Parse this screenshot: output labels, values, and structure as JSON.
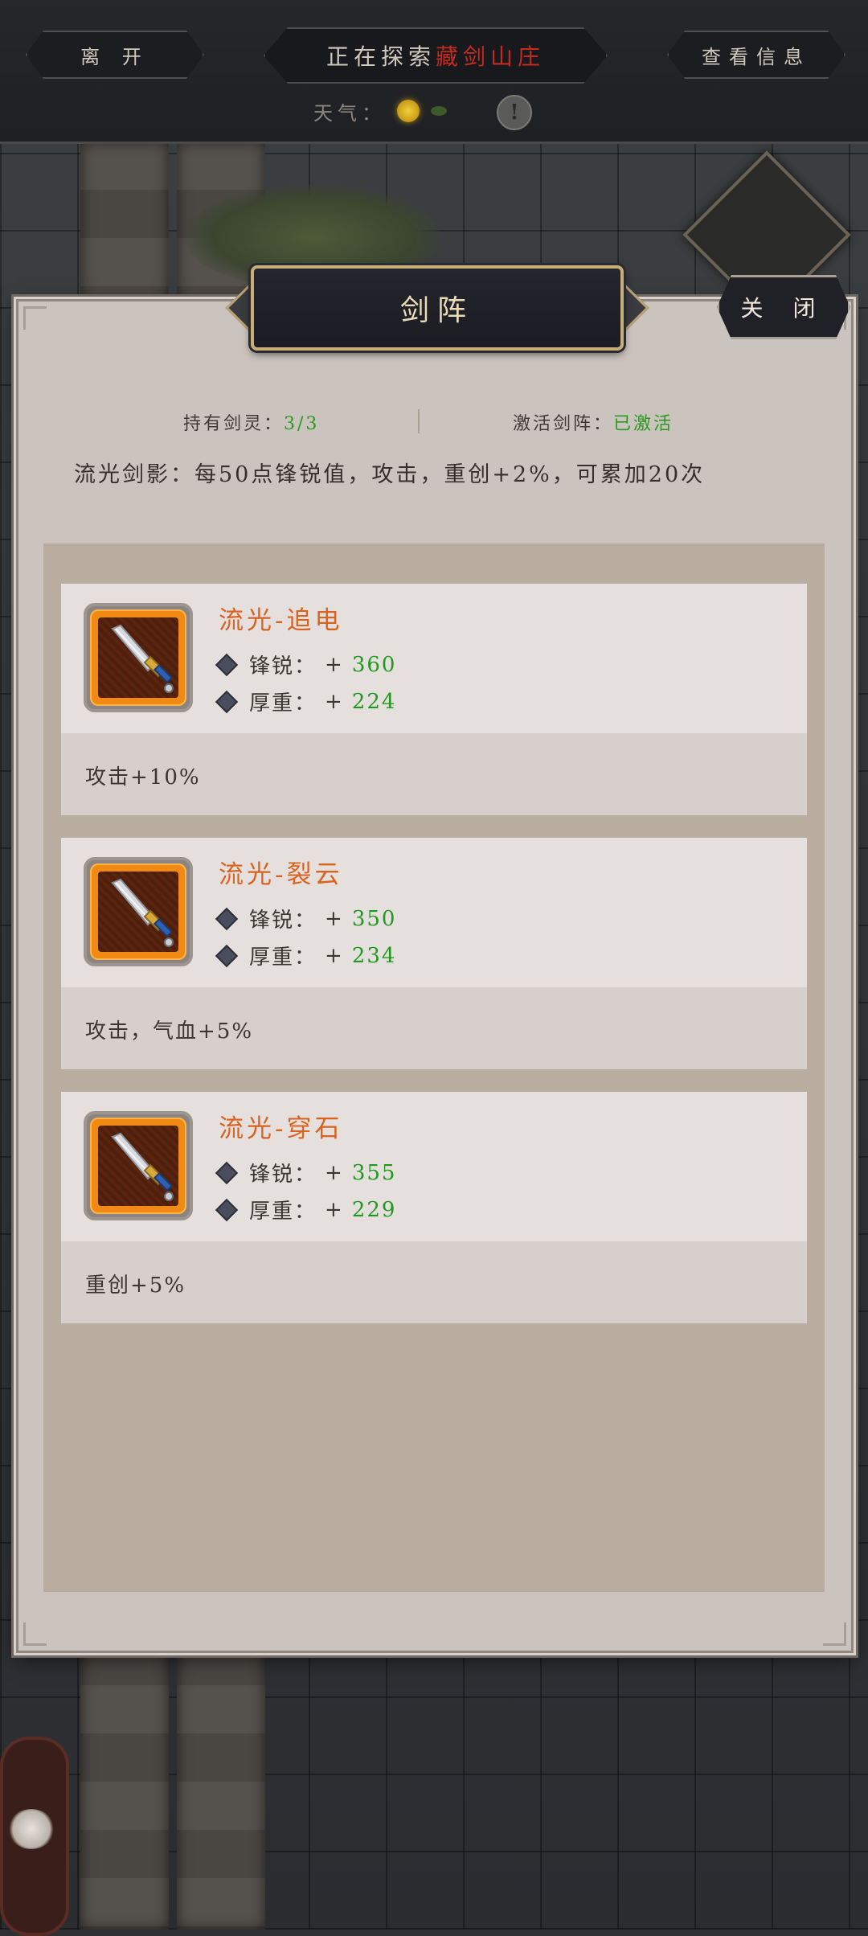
{
  "top_bar": {
    "leave_label": "离 开",
    "exploring_prefix": "正在探索",
    "exploring_location": "藏剑山庄",
    "info_label": "查看信息",
    "weather_label": "天气：",
    "weather_icons": [
      "sun-icon",
      "leaf-icon"
    ],
    "alert_symbol": "!"
  },
  "panel": {
    "title": "剑阵",
    "close_label": "关 闭",
    "held_label": "持有剑灵：",
    "held_value": "3/3",
    "array_label": "激活剑阵：",
    "array_status": "已激活",
    "effect_text": "流光剑影：每50点锋锐值，攻击，重创+2%，可累加20次"
  },
  "swords": [
    {
      "name": "流光-追电",
      "stats": [
        {
          "label": "锋锐：",
          "prefix": "+",
          "value": "360"
        },
        {
          "label": "厚重：",
          "prefix": "+",
          "value": "224"
        }
      ],
      "effect": "攻击+10%"
    },
    {
      "name": "流光-裂云",
      "stats": [
        {
          "label": "锋锐：",
          "prefix": "+",
          "value": "350"
        },
        {
          "label": "厚重：",
          "prefix": "+",
          "value": "234"
        }
      ],
      "effect": "攻击，气血+5%"
    },
    {
      "name": "流光-穿石",
      "stats": [
        {
          "label": "锋锐：",
          "prefix": "+",
          "value": "355"
        },
        {
          "label": "厚重：",
          "prefix": "+",
          "value": "229"
        }
      ],
      "effect": "重创+5%"
    }
  ],
  "colors": {
    "accent_name": "#d9621e",
    "stat_value": "#1f9a1f",
    "location_red": "#c42a1e",
    "title_gold": "#eadcb8"
  }
}
